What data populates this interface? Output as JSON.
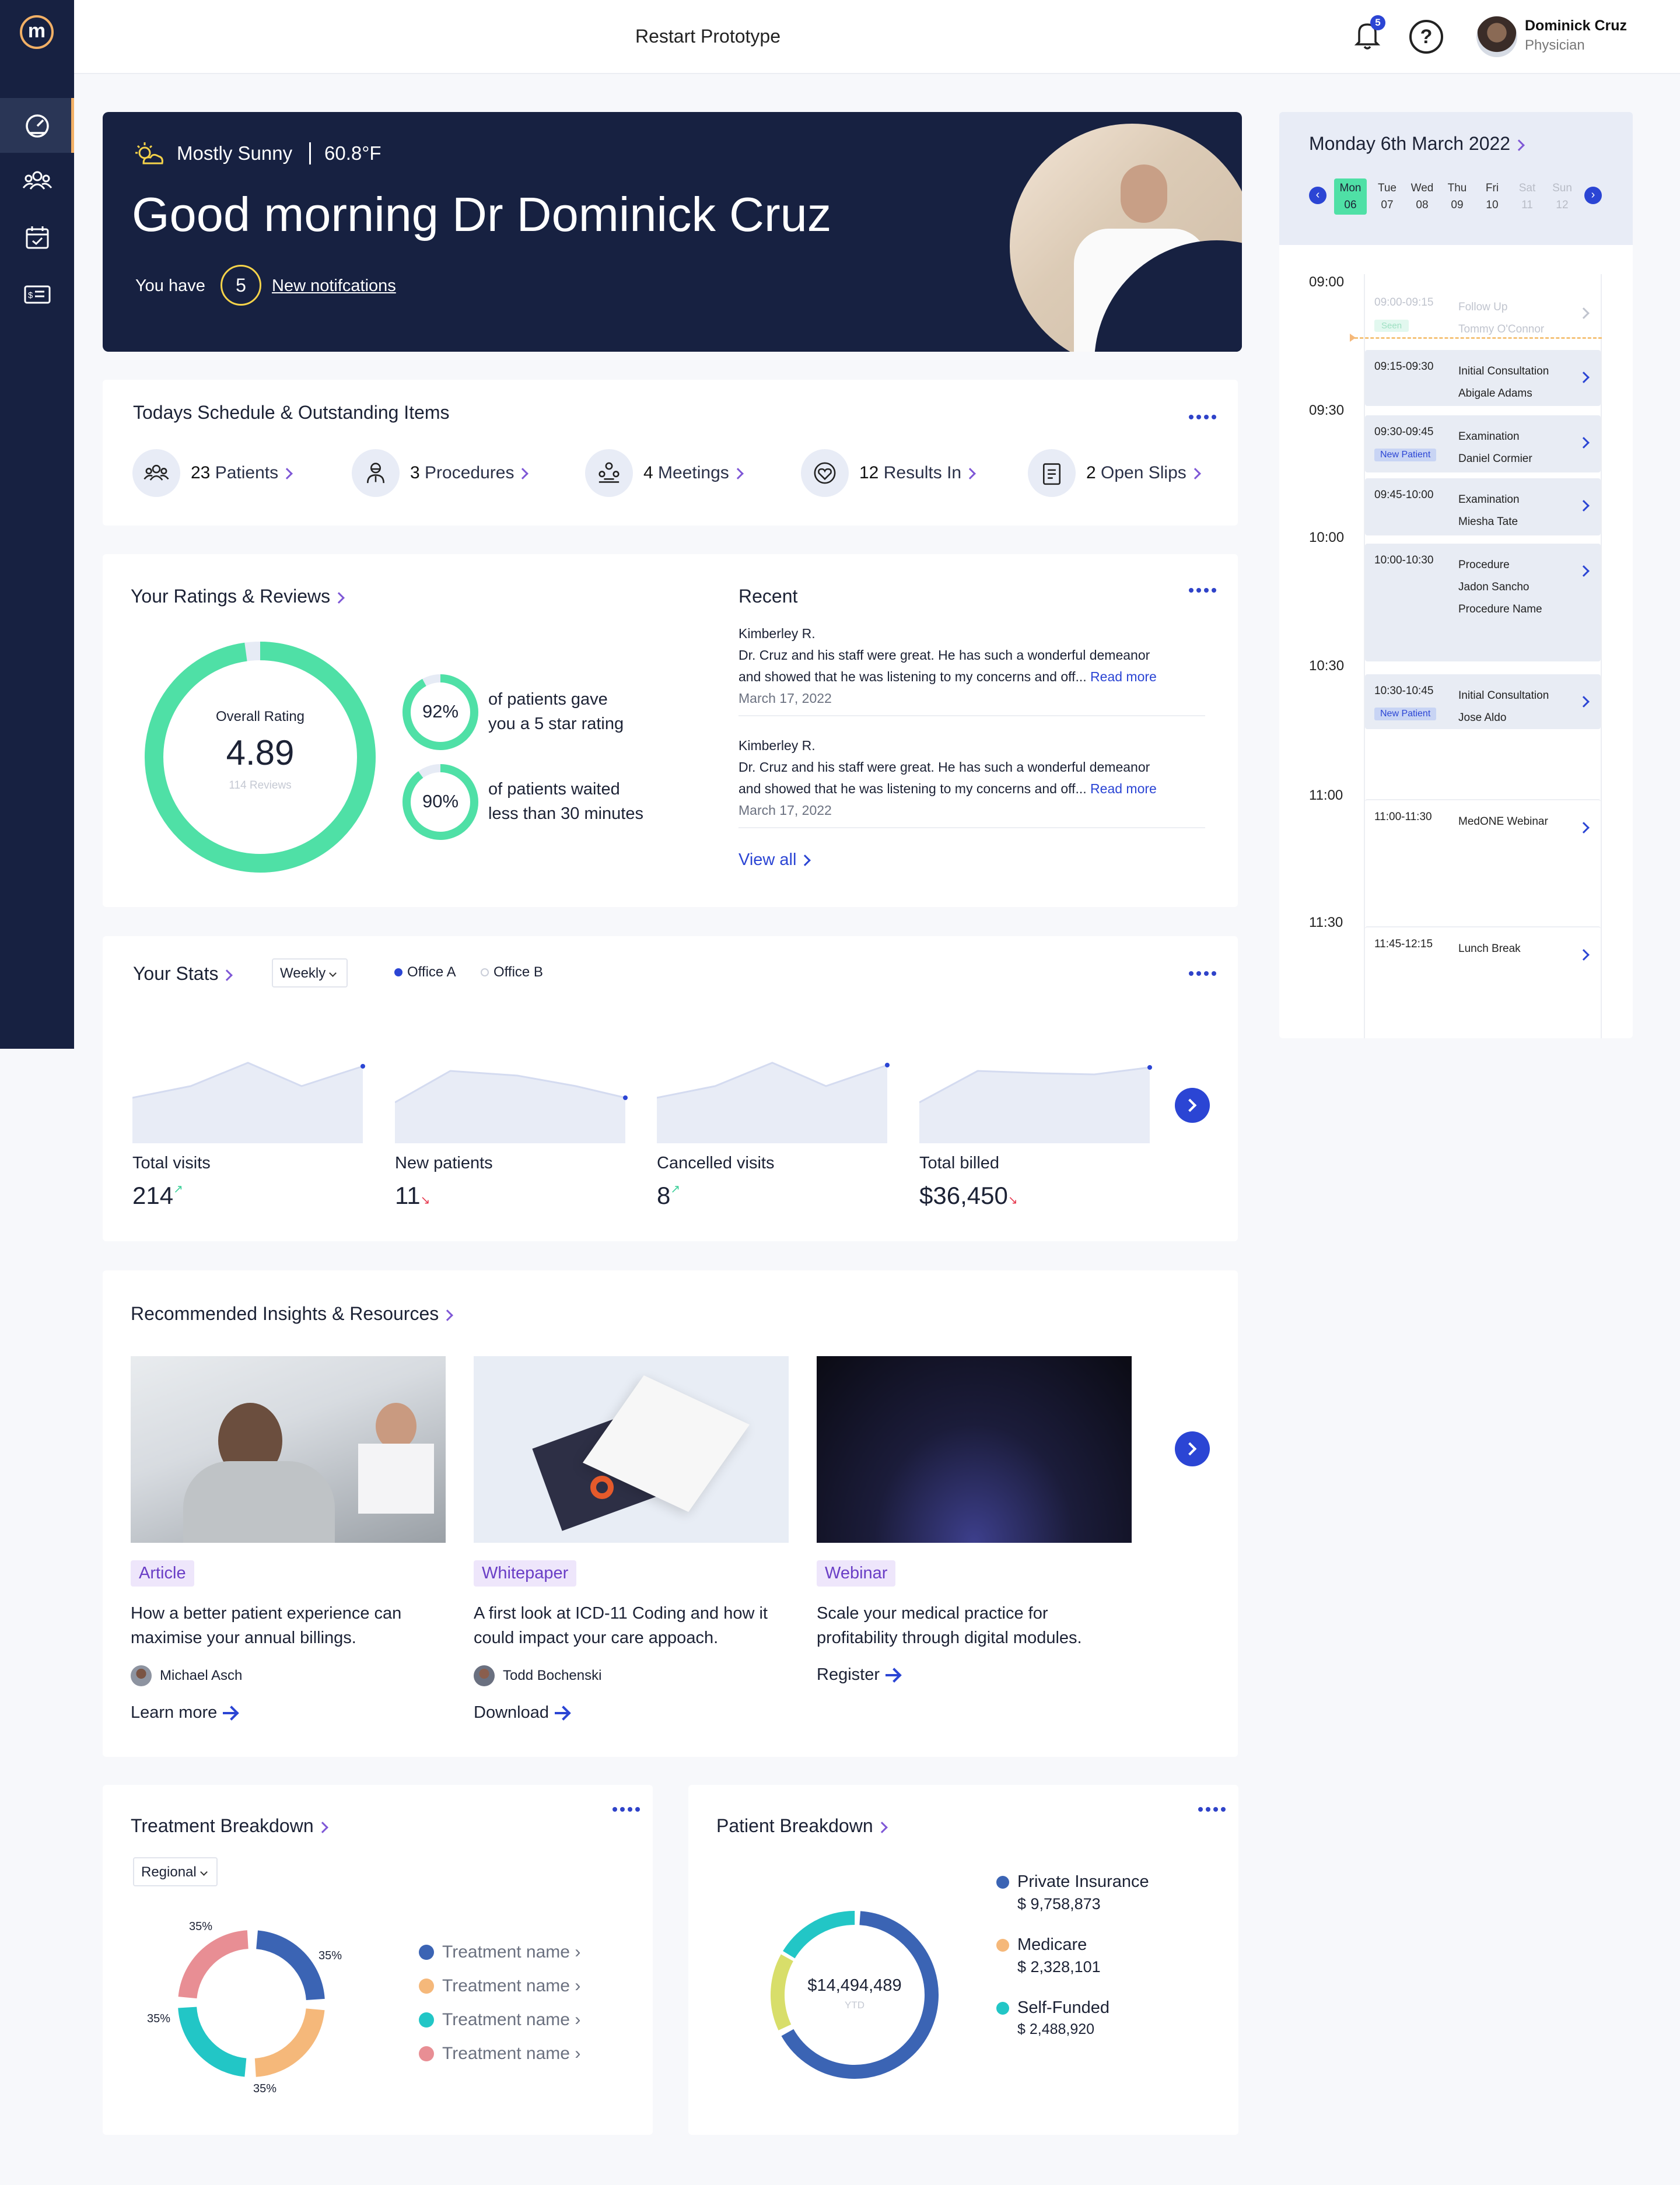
{
  "app": {
    "title": "Restart Prototype",
    "notifications_count": "5",
    "user_name": "Dominick Cruz",
    "user_role": "Physician"
  },
  "sidebar": {
    "items": [
      {
        "icon": "dashboard-icon",
        "active": true
      },
      {
        "icon": "patients-icon"
      },
      {
        "icon": "calendar-icon"
      },
      {
        "icon": "billing-icon"
      }
    ]
  },
  "hero": {
    "weather": "Mostly Sunny",
    "temperature": "60.8°F",
    "greeting": "Good morning Dr Dominick Cruz",
    "you_have": "You have",
    "notif_count": "5",
    "notif_link": "New notifcations"
  },
  "schedule": {
    "title": "Todays Schedule & Outstanding Items",
    "items": [
      {
        "count": "23",
        "label": "Patients",
        "icon": "patients-icon"
      },
      {
        "count": "3",
        "label": "Procedures",
        "icon": "surgeon-icon"
      },
      {
        "count": "4",
        "label": "Meetings",
        "icon": "meeting-icon"
      },
      {
        "count": "12",
        "label": "Results In",
        "icon": "results-icon"
      },
      {
        "count": "2",
        "label": "Open Slips",
        "icon": "clipboard-icon"
      }
    ]
  },
  "ratings": {
    "title": "Your Ratings & Reviews",
    "overall_label": "Overall Rating",
    "overall_value": "4.89",
    "reviews": "114 Reviews",
    "overall_fraction": 0.978,
    "stats": [
      {
        "pct": "92%",
        "fraction": 0.92,
        "line1": "of patients gave",
        "line2": "you a 5 star rating"
      },
      {
        "pct": "90%",
        "fraction": 0.9,
        "line1": "of patients waited",
        "line2": "less than 30 minutes"
      }
    ],
    "recent_title": "Recent",
    "recent": [
      {
        "name": "Kimberley R.",
        "text1": "Dr. Cruz and his staff were great. He has such a wonderful demeanor",
        "text2": "and showed that he was listening to my concerns and off...",
        "more": "Read more",
        "date": "March 17, 2022"
      },
      {
        "name": "Kimberley R.",
        "text1": "Dr. Cruz and his staff were great. He has such a wonderful demeanor",
        "text2": "and showed that he was listening to my concerns and off...",
        "more": "Read more",
        "date": "March 17, 2022"
      }
    ],
    "view_all": "View all"
  },
  "stats": {
    "title": "Your Stats",
    "period": "Weekly",
    "legend": [
      {
        "name": "Office A",
        "color": "#2b45d4"
      },
      {
        "name": "Office B",
        "color": "#c9cdd8"
      }
    ],
    "cards": [
      {
        "label": "Total visits",
        "value": "214",
        "trend": "up"
      },
      {
        "label": "New patients",
        "value": "11",
        "trend": "down"
      },
      {
        "label": "Cancelled visits",
        "value": "8",
        "trend": "up"
      },
      {
        "label": "Total billed",
        "value": "$36,450",
        "trend": "down"
      }
    ]
  },
  "insights": {
    "title": "Recommended Insights & Resources",
    "items": [
      {
        "tag": "Article",
        "line1": "How a better patient experience can",
        "line2": "maximise your annual billings.",
        "author": "Michael Asch",
        "action": "Learn more"
      },
      {
        "tag": "Whitepaper",
        "line1": "A first look at ICD-11 Coding and how it",
        "line2": "could impact your care appoach.",
        "author": "Todd Bochenski",
        "action": "Download"
      },
      {
        "tag": "Webinar",
        "line1": "Scale your medical practice for",
        "line2": "profitability through digital modules.",
        "author": "",
        "action": "Register"
      }
    ]
  },
  "treatment": {
    "title": "Treatment Breakdown",
    "filter": "Regional",
    "legend": [
      "Treatment name ›",
      "Treatment name ›",
      "Treatment name ›",
      "Treatment name ›"
    ],
    "labels": [
      "35%",
      "35%",
      "35%",
      "35%"
    ]
  },
  "patient": {
    "title": "Patient Breakdown",
    "total": "$14,494,489",
    "total_sub": "YTD",
    "items": [
      {
        "name": "Private Insurance",
        "value": "$ 9,758,873",
        "color": "#3b64b4"
      },
      {
        "name": "Medicare",
        "value": "$ 2,328,101",
        "color": "#f5b87a"
      },
      {
        "name": "Self-Funded",
        "value": "$ 2,488,920",
        "color": "#22c6c6"
      }
    ]
  },
  "calendar": {
    "title": "Monday 6th March 2022",
    "days": [
      {
        "d": "Mon",
        "n": "06"
      },
      {
        "d": "Tue",
        "n": "07"
      },
      {
        "d": "Wed",
        "n": "08"
      },
      {
        "d": "Thu",
        "n": "09"
      },
      {
        "d": "Fri",
        "n": "10"
      },
      {
        "d": "Sat",
        "n": "11"
      },
      {
        "d": "Sun",
        "n": "12"
      }
    ],
    "times": [
      "09:00",
      "09:30",
      "10:00",
      "10:30",
      "11:00",
      "11:30"
    ],
    "appts": [
      {
        "time": "09:00-09:15",
        "title": "Follow Up",
        "name": "Tommy O'Connor",
        "badge": "Seen"
      },
      {
        "time": "09:15-09:30",
        "title": "Initial Consultation",
        "name": "Abigale Adams"
      },
      {
        "time": "09:30-09:45",
        "title": "Examination",
        "name": "Daniel Cormier",
        "badge": "New Patient"
      },
      {
        "time": "09:45-10:00",
        "title": "Examination",
        "name": "Miesha Tate"
      },
      {
        "time": "10:00-10:30",
        "title": "Procedure",
        "name": "Jadon Sancho",
        "extra": "Procedure Name"
      },
      {
        "time": "10:30-10:45",
        "title": "Initial Consultation",
        "name": "Jose Aldo",
        "badge": "New Patient"
      },
      {
        "time": "11:00-11:30",
        "title": "MedONE Webinar"
      },
      {
        "time": "11:45-12:15",
        "title": "Lunch Break"
      }
    ]
  }
}
